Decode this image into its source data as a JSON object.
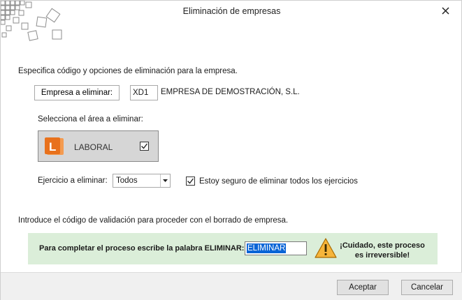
{
  "window": {
    "title": "Eliminación de empresas"
  },
  "instructions": "Especifica código y opciones de eliminación para la empresa.",
  "empresa": {
    "button_label": "Empresa a eliminar:",
    "code": "XD1",
    "name": "EMPRESA DE DEMOSTRACIÓN, S.L."
  },
  "area": {
    "label": "Selecciona el área a eliminar:",
    "tile_label": "LABORAL",
    "checked": true,
    "icon_letter": "L",
    "icon_color": "#e8711c"
  },
  "ejercicio": {
    "label": "Ejercicio a eliminar:",
    "selected": "Todos",
    "confirm_label": "Estoy seguro de eliminar todos los ejercicios",
    "confirm_checked": true
  },
  "validation": {
    "instruction": "Introduce el código de validación para proceder con el borrado de empresa.",
    "prompt": "Para completar el proceso escribe la palabra ELIMINAR:",
    "input_value": "ELIMINAR",
    "warning_line1": "¡Cuidado, este proceso",
    "warning_line2": "es irreversible!",
    "panel_color": "#dbeed9"
  },
  "footer": {
    "accept_label": "Aceptar",
    "cancel_label": "Cancelar"
  }
}
